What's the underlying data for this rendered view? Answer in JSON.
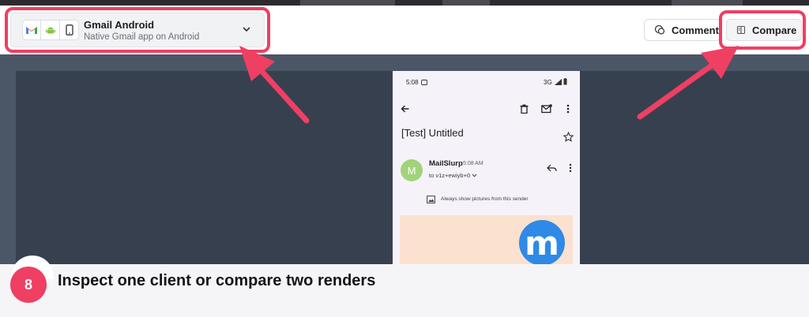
{
  "client_selector": {
    "name": "Gmail Android",
    "description": "Native Gmail app on Android",
    "icons": [
      "gmail-icon",
      "android-icon",
      "phone-icon"
    ]
  },
  "toolbar": {
    "comment_label": "Comment",
    "compare_label": "Compare"
  },
  "email": {
    "status_time": "5:08",
    "status_network": "3G",
    "subject": "[Test] Untitled",
    "avatar_letter": "M",
    "sender": "MailSlurp",
    "time": "5:08 AM",
    "recipient": "to v1z+ewiyb+0",
    "pictures_note": "Always show pictures from this sender",
    "logo_letter": "m"
  },
  "caption": {
    "step_number": "8",
    "text": "Inspect one client or compare two renders"
  },
  "colors": {
    "accent": "#ef3f63",
    "preview_background": "#37404f",
    "avatar": "#a0d37a",
    "logo": "#2e8ae6"
  }
}
